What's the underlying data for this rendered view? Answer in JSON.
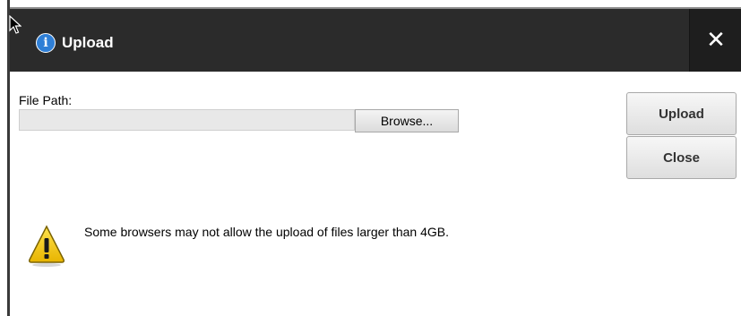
{
  "dialog": {
    "title": "Upload",
    "title_icon": "info-icon",
    "close_icon": "close-icon",
    "close_glyph": "✕"
  },
  "form": {
    "file_path_label": "File Path:",
    "file_path_value": "",
    "browse_label": "Browse..."
  },
  "actions": {
    "upload_label": "Upload",
    "close_label": "Close"
  },
  "notice": {
    "icon": "warning-icon",
    "text": "Some browsers may not allow the upload of files larger than 4GB."
  },
  "colors": {
    "title_bar": "#2b2b2b",
    "info_blue": "#2f7fd6",
    "warning_yellow": "#f2c500"
  }
}
